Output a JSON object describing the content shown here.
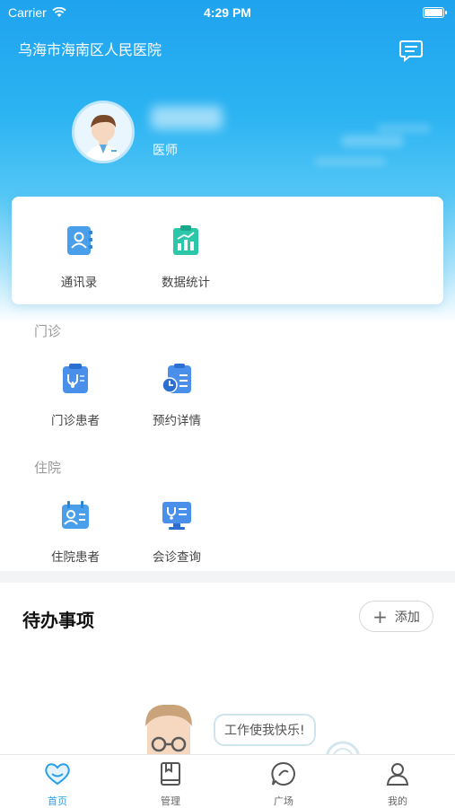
{
  "status_bar": {
    "carrier": "Carrier",
    "time": "4:29 PM"
  },
  "header": {
    "hospital_name": "乌海市海南区人民医院"
  },
  "profile": {
    "role": "医师"
  },
  "quick_card": {
    "items": [
      {
        "label": "通讯录",
        "icon": "contacts-book-icon"
      },
      {
        "label": "数据统计",
        "icon": "data-stats-icon"
      }
    ]
  },
  "outpatient": {
    "title": "门诊",
    "items": [
      {
        "label": "门诊患者",
        "icon": "outpatient-clipboard-icon"
      },
      {
        "label": "预约详情",
        "icon": "appointment-clock-icon"
      }
    ]
  },
  "inpatient": {
    "title": "住院",
    "items": [
      {
        "label": "住院患者",
        "icon": "inpatient-card-icon"
      },
      {
        "label": "会诊查询",
        "icon": "consultation-monitor-icon"
      }
    ]
  },
  "todo": {
    "title": "待办事项",
    "add_label": "添加",
    "speech": "工作使我快乐!"
  },
  "tabbar": {
    "tabs": [
      {
        "label": "首页",
        "icon": "home-heart-icon",
        "active": true
      },
      {
        "label": "管理",
        "icon": "book-icon",
        "active": false
      },
      {
        "label": "广场",
        "icon": "chat-bubble-icon",
        "active": false
      },
      {
        "label": "我的",
        "icon": "person-icon",
        "active": false
      }
    ]
  },
  "colors": {
    "accent": "#2a9fe8",
    "header_blue": "#1fa3ee",
    "teal": "#2cc6a8"
  }
}
